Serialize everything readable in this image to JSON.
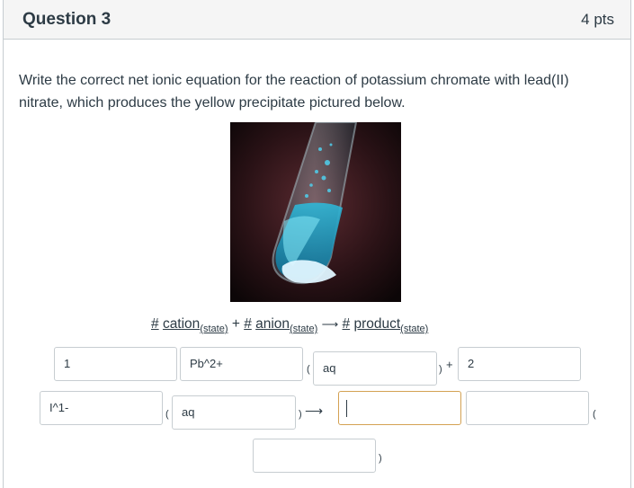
{
  "question": {
    "title": "Question 3",
    "points": "4 pts",
    "prompt": "Write the correct net ionic equation for the reaction of potassium chromate with lead(II) nitrate, which produces the yellow precipitate pictured below."
  },
  "equation_template": {
    "hash1": "#",
    "cation": "cation",
    "state1": "(state)",
    "plus": "+",
    "hash2": "#",
    "anion": "anion",
    "state2": "(state)",
    "arrow": "⟶",
    "hash3": "#",
    "product": "product",
    "state3": "(state)"
  },
  "answers": {
    "row1": {
      "coef1": "1",
      "cation": "Pb^2+",
      "open_paren": "(",
      "state1": "aq",
      "close_paren": ")",
      "plus": "+",
      "coef2": "2"
    },
    "row2": {
      "anion": "I^1-",
      "open_paren": "(",
      "state2": "aq",
      "close_paren": ")",
      "arrow": "⟶",
      "coef3": "",
      "product": "",
      "open_paren2": "("
    },
    "row3": {
      "state3": "",
      "close_paren": ")"
    }
  }
}
